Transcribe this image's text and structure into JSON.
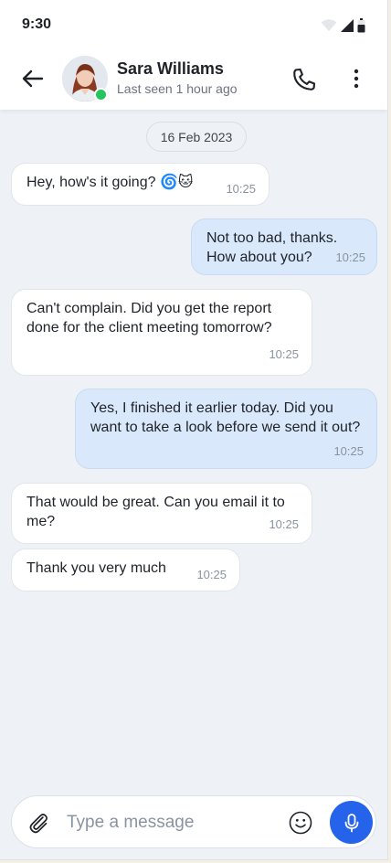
{
  "status_bar": {
    "time": "9:30"
  },
  "header": {
    "contact_name": "Sara Williams",
    "contact_status": "Last seen 1 hour ago",
    "online_color": "#22c55e"
  },
  "date_chip": "16 Feb 2023",
  "messages": [
    {
      "direction": "incoming",
      "text": "Hey, how's it going? 🌀🐱",
      "time": "10:25"
    },
    {
      "direction": "outgoing",
      "text": "Not too bad, thanks.\nHow about you?",
      "time": "10:25"
    },
    {
      "direction": "incoming",
      "text": "Can't complain. Did you get the report done for the client meeting tomorrow?",
      "time": "10:25"
    },
    {
      "direction": "outgoing",
      "text": "Yes, I finished it earlier today. Did you want to take a look before we send it out?",
      "time": "10:25"
    },
    {
      "direction": "incoming",
      "text": "That would be great. Can you email it to me?",
      "time": "10:25"
    },
    {
      "direction": "incoming",
      "text": "Thank you very much",
      "time": "10:25"
    }
  ],
  "composer": {
    "placeholder": "Type a message"
  },
  "icons": {
    "back": "arrow-left-icon",
    "call": "phone-icon",
    "more": "more-vertical-icon",
    "attach": "paperclip-icon",
    "emoji": "smiley-icon",
    "mic": "microphone-icon"
  },
  "colors": {
    "accent": "#2563eb",
    "outgoing_bubble": "#d9e8fa",
    "incoming_bubble": "#ffffff",
    "chat_background": "#eef2f7"
  }
}
